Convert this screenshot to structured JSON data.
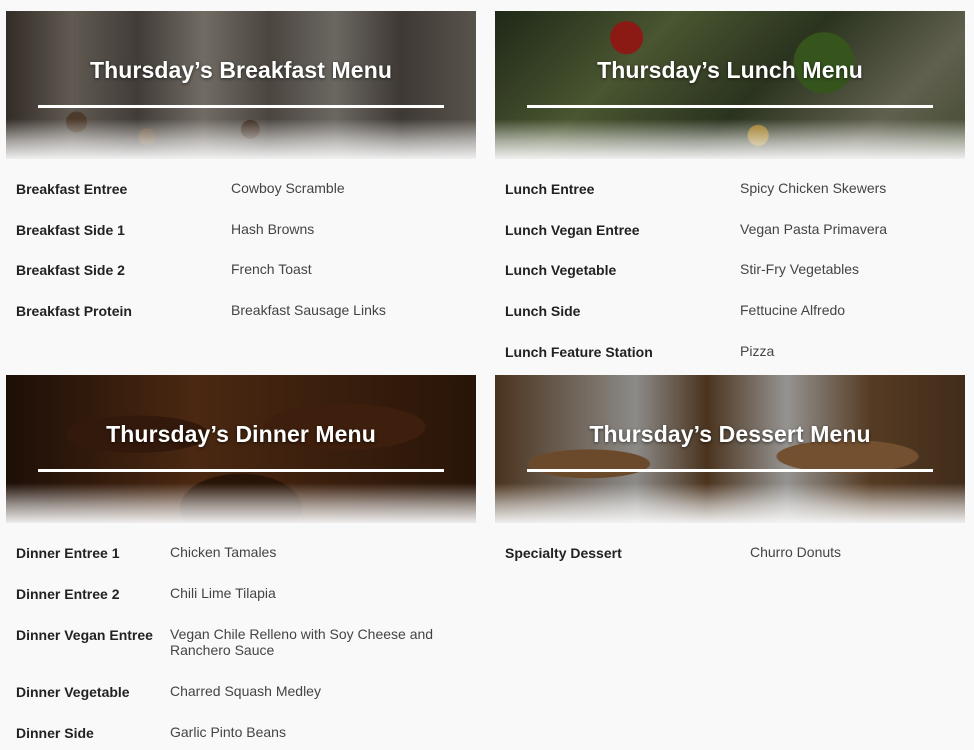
{
  "breakfast": {
    "title": "Thursday’s Breakfast Menu",
    "items": [
      {
        "label": "Breakfast Entree",
        "value": "Cowboy Scramble"
      },
      {
        "label": "Breakfast Side 1",
        "value": "Hash Browns"
      },
      {
        "label": "Breakfast Side 2",
        "value": "French Toast"
      },
      {
        "label": "Breakfast Protein",
        "value": "Breakfast Sausage Links"
      }
    ]
  },
  "lunch": {
    "title": "Thursday’s Lunch Menu",
    "items": [
      {
        "label": "Lunch Entree",
        "value": "Spicy Chicken Skewers"
      },
      {
        "label": "Lunch Vegan Entree",
        "value": "Vegan Pasta Primavera"
      },
      {
        "label": "Lunch Vegetable",
        "value": "Stir-Fry Vegetables"
      },
      {
        "label": "Lunch Side",
        "value": "Fettucine Alfredo"
      },
      {
        "label": "Lunch Feature Station",
        "value": "Pizza"
      }
    ]
  },
  "dinner": {
    "title": "Thursday’s Dinner Menu",
    "items": [
      {
        "label": "Dinner Entree 1",
        "value": "Chicken Tamales"
      },
      {
        "label": "Dinner Entree 2",
        "value": "Chili Lime Tilapia"
      },
      {
        "label": "Dinner Vegan Entree",
        "value": "Vegan Chile Relleno with Soy Cheese and Ranchero Sauce"
      },
      {
        "label": "Dinner Vegetable",
        "value": "Charred Squash Medley"
      },
      {
        "label": "Dinner Side",
        "value": "Garlic Pinto Beans"
      }
    ]
  },
  "dessert": {
    "title": "Thursday’s Dessert Menu",
    "items": [
      {
        "label": "Specialty Dessert",
        "value": "Churro Donuts"
      }
    ]
  }
}
